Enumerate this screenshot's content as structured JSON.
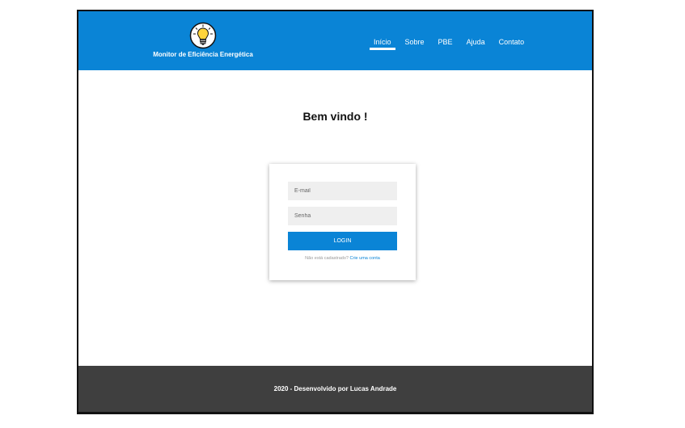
{
  "header": {
    "brand_title": "Monitor de Eficiência Energética",
    "logo_icon": "lightbulb-icon",
    "nav": [
      {
        "label": "Início",
        "active": true
      },
      {
        "label": "Sobre",
        "active": false
      },
      {
        "label": "PBE",
        "active": false
      },
      {
        "label": "Ajuda",
        "active": false
      },
      {
        "label": "Contato",
        "active": false
      }
    ]
  },
  "main": {
    "welcome": "Bem vindo !"
  },
  "login": {
    "email_placeholder": "E-mail",
    "password_placeholder": "Senha",
    "button_label": "LOGIN",
    "signup_prompt": "Não está cadastrado?",
    "signup_link": "Crie uma conta"
  },
  "footer": {
    "text": "2020 - Desenvolvido por Lucas Andrade"
  },
  "colors": {
    "primary": "#0a84d6",
    "footer_bg": "#3f3f3f",
    "input_bg": "#efefef"
  }
}
